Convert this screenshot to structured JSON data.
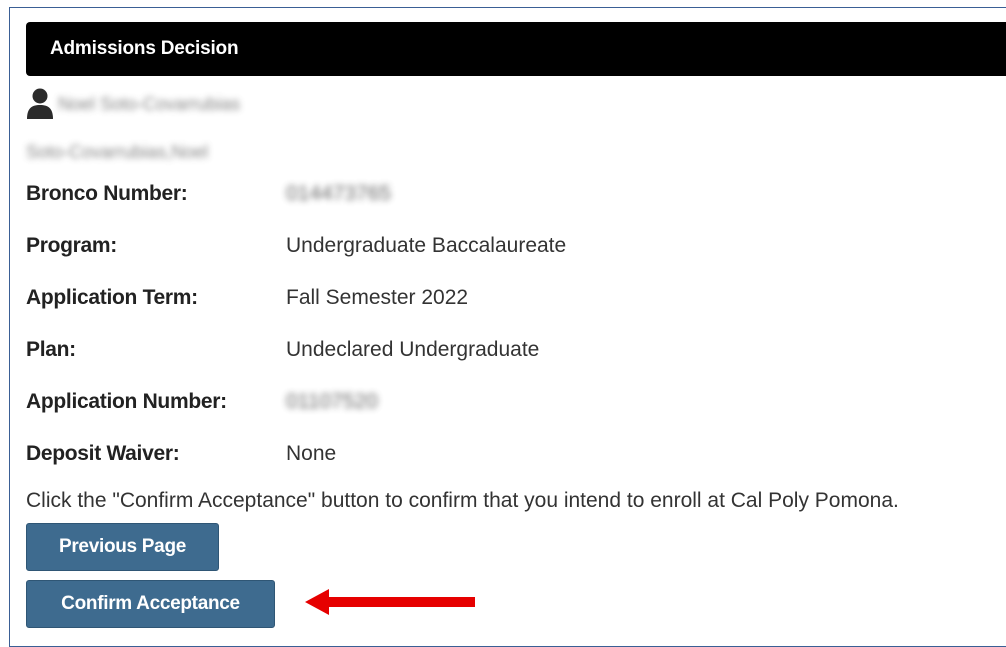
{
  "header": {
    "title": "Admissions Decision"
  },
  "user": {
    "icon": "user-icon",
    "display_name": "Noel Soto-Covarrubias",
    "sort_name": "Soto-Covarrubias,Noel"
  },
  "fields": [
    {
      "label": "Bronco Number:",
      "value": "014473765",
      "blurred": true
    },
    {
      "label": "Program:",
      "value": "Undergraduate Baccalaureate",
      "blurred": false
    },
    {
      "label": "Application Term:",
      "value": "Fall Semester 2022",
      "blurred": false
    },
    {
      "label": "Plan:",
      "value": "Undeclared Undergraduate",
      "blurred": false
    },
    {
      "label": "Application Number:",
      "value": "01107520",
      "blurred": true
    },
    {
      "label": "Deposit Waiver:",
      "value": "None",
      "blurred": false
    }
  ],
  "instruction": "Click the \"Confirm Acceptance\" button to confirm that you intend to enroll at Cal Poly Pomona.",
  "buttons": {
    "previous_label": "Previous Page",
    "confirm_label": "Confirm Acceptance"
  },
  "colors": {
    "header_bg": "#000000",
    "button_bg": "#3e6b8f",
    "annotation_arrow": "#e60000",
    "frame_border": "#3a5f95"
  }
}
